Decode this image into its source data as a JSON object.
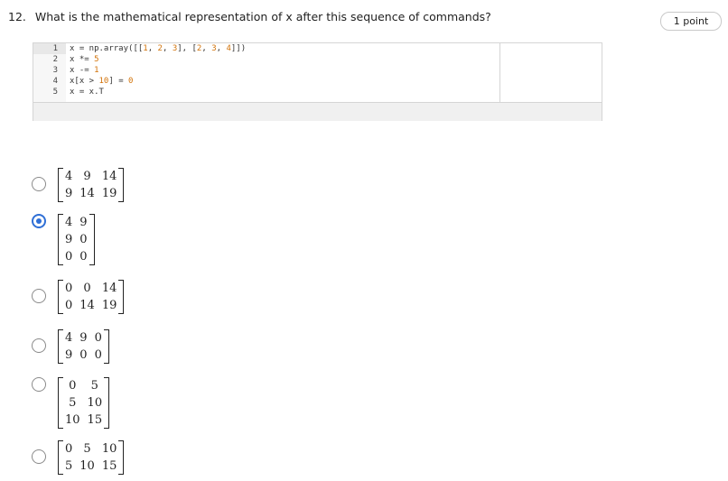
{
  "question": {
    "number": "12.",
    "text": "What is the mathematical representation of x after this sequence of commands?",
    "points": "1 point"
  },
  "code": {
    "line_numbers": [
      "1",
      "2",
      "3",
      "4",
      "5"
    ],
    "lines": [
      "x = np.array([[1, 2, 3], [2, 3, 4]])",
      "x *= 5",
      "x -= 1",
      "x[x > 10] = 0",
      "x = x.T"
    ]
  },
  "options": [
    {
      "selected": false,
      "matrix": [
        [
          "4",
          "9",
          "14"
        ],
        [
          "9",
          "14",
          "19"
        ]
      ]
    },
    {
      "selected": true,
      "matrix": [
        [
          "4",
          "9"
        ],
        [
          "9",
          "0"
        ],
        [
          "0",
          "0"
        ]
      ]
    },
    {
      "selected": false,
      "matrix": [
        [
          "0",
          "0",
          "14"
        ],
        [
          "0",
          "14",
          "19"
        ]
      ]
    },
    {
      "selected": false,
      "matrix": [
        [
          "4",
          "9",
          "0"
        ],
        [
          "9",
          "0",
          "0"
        ]
      ]
    },
    {
      "selected": false,
      "matrix": [
        [
          "0",
          "5"
        ],
        [
          "5",
          "10"
        ],
        [
          "10",
          "15"
        ]
      ]
    },
    {
      "selected": false,
      "matrix": [
        [
          "0",
          "5",
          "10"
        ],
        [
          "5",
          "10",
          "15"
        ]
      ]
    }
  ],
  "colors": {
    "accent": "#2f6fd6",
    "number_literal": "#d2730a"
  }
}
